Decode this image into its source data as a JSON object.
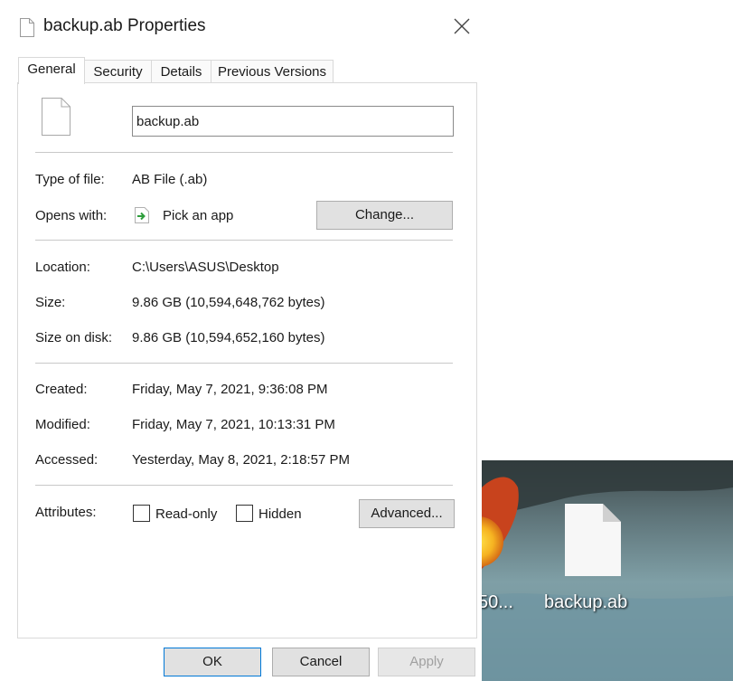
{
  "dialog": {
    "title": "backup.ab Properties",
    "close_icon": "close-icon",
    "tabs": [
      {
        "label": "General"
      },
      {
        "label": "Security"
      },
      {
        "label": "Details"
      },
      {
        "label": "Previous Versions"
      }
    ],
    "active_tab": "General",
    "file_name": "backup.ab",
    "type_of_file": {
      "label": "Type of file:",
      "value": "AB File (.ab)"
    },
    "opens_with": {
      "label": "Opens with:",
      "value": "Pick an app",
      "button": "Change..."
    },
    "location": {
      "label": "Location:",
      "value": "C:\\Users\\ASUS\\Desktop"
    },
    "size": {
      "label": "Size:",
      "value": "9.86 GB (10,594,648,762 bytes)"
    },
    "size_on_disk": {
      "label": "Size on disk:",
      "value": "9.86 GB (10,594,652,160 bytes)"
    },
    "created": {
      "label": "Created:",
      "value": "Friday, May 7, 2021, 9:36:08 PM"
    },
    "modified": {
      "label": "Modified:",
      "value": "Friday, May 7, 2021, 10:13:31 PM"
    },
    "accessed": {
      "label": "Accessed:",
      "value": "Yesterday, May 8, 2021, 2:18:57 PM"
    },
    "attributes": {
      "label": "Attributes:",
      "read_only": {
        "label": "Read-only",
        "checked": false
      },
      "hidden": {
        "label": "Hidden",
        "checked": false
      },
      "advanced_button": "Advanced..."
    },
    "footer": {
      "ok": "OK",
      "cancel": "Cancel",
      "apply": "Apply"
    },
    "accent_color": "#0078d7"
  },
  "desktop": {
    "truncated_label": "50...",
    "file_label": "backup.ab"
  }
}
